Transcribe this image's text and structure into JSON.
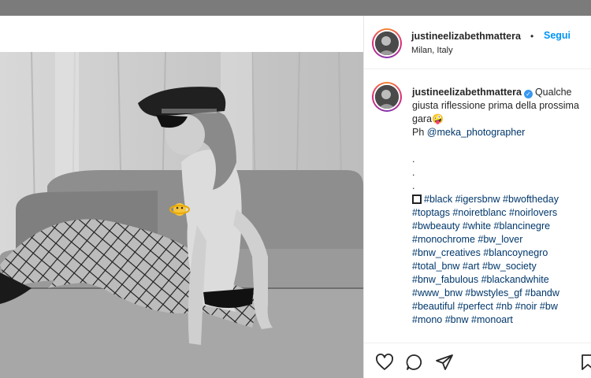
{
  "post": {
    "username": "justineelizabethmattera",
    "location": "Milan, Italy",
    "follow_label": "Segui",
    "separator": "•",
    "caption": {
      "text_before_emoji": "Qualche giusta riflessione prima della prossima gara",
      "emoji": "🤪",
      "photo_credit_prefix": "Ph ",
      "mention": "@meka_photographer",
      "dots": [
        ".",
        ".",
        "."
      ],
      "hashtags": "#black #igersbnw #bwoftheday #toptags #noiretblanc #noirlovers #bwbeauty #white #blancinegre #monochrome #bw_lover #bnw_creatives #blancoynegro #total_bnw #art #bw_society #bnw_fabulous #blackandwhite #www_bnw #bwstyles_gf #bandw #beautiful #perfect #nb #noir #bw #mono #bnw #monoart"
    }
  },
  "icons": {
    "like": "heart-icon",
    "comment": "comment-icon",
    "share": "paper-plane-icon",
    "save": "bookmark-icon",
    "verified": "verified-badge-icon",
    "stop": "square-icon",
    "sticker": "dizzy-emoji-sticker-icon"
  },
  "colors": {
    "link": "#0095f6",
    "hashtag": "#00376b",
    "verified": "#3897f0",
    "top_bar": "#7b7b7b"
  }
}
